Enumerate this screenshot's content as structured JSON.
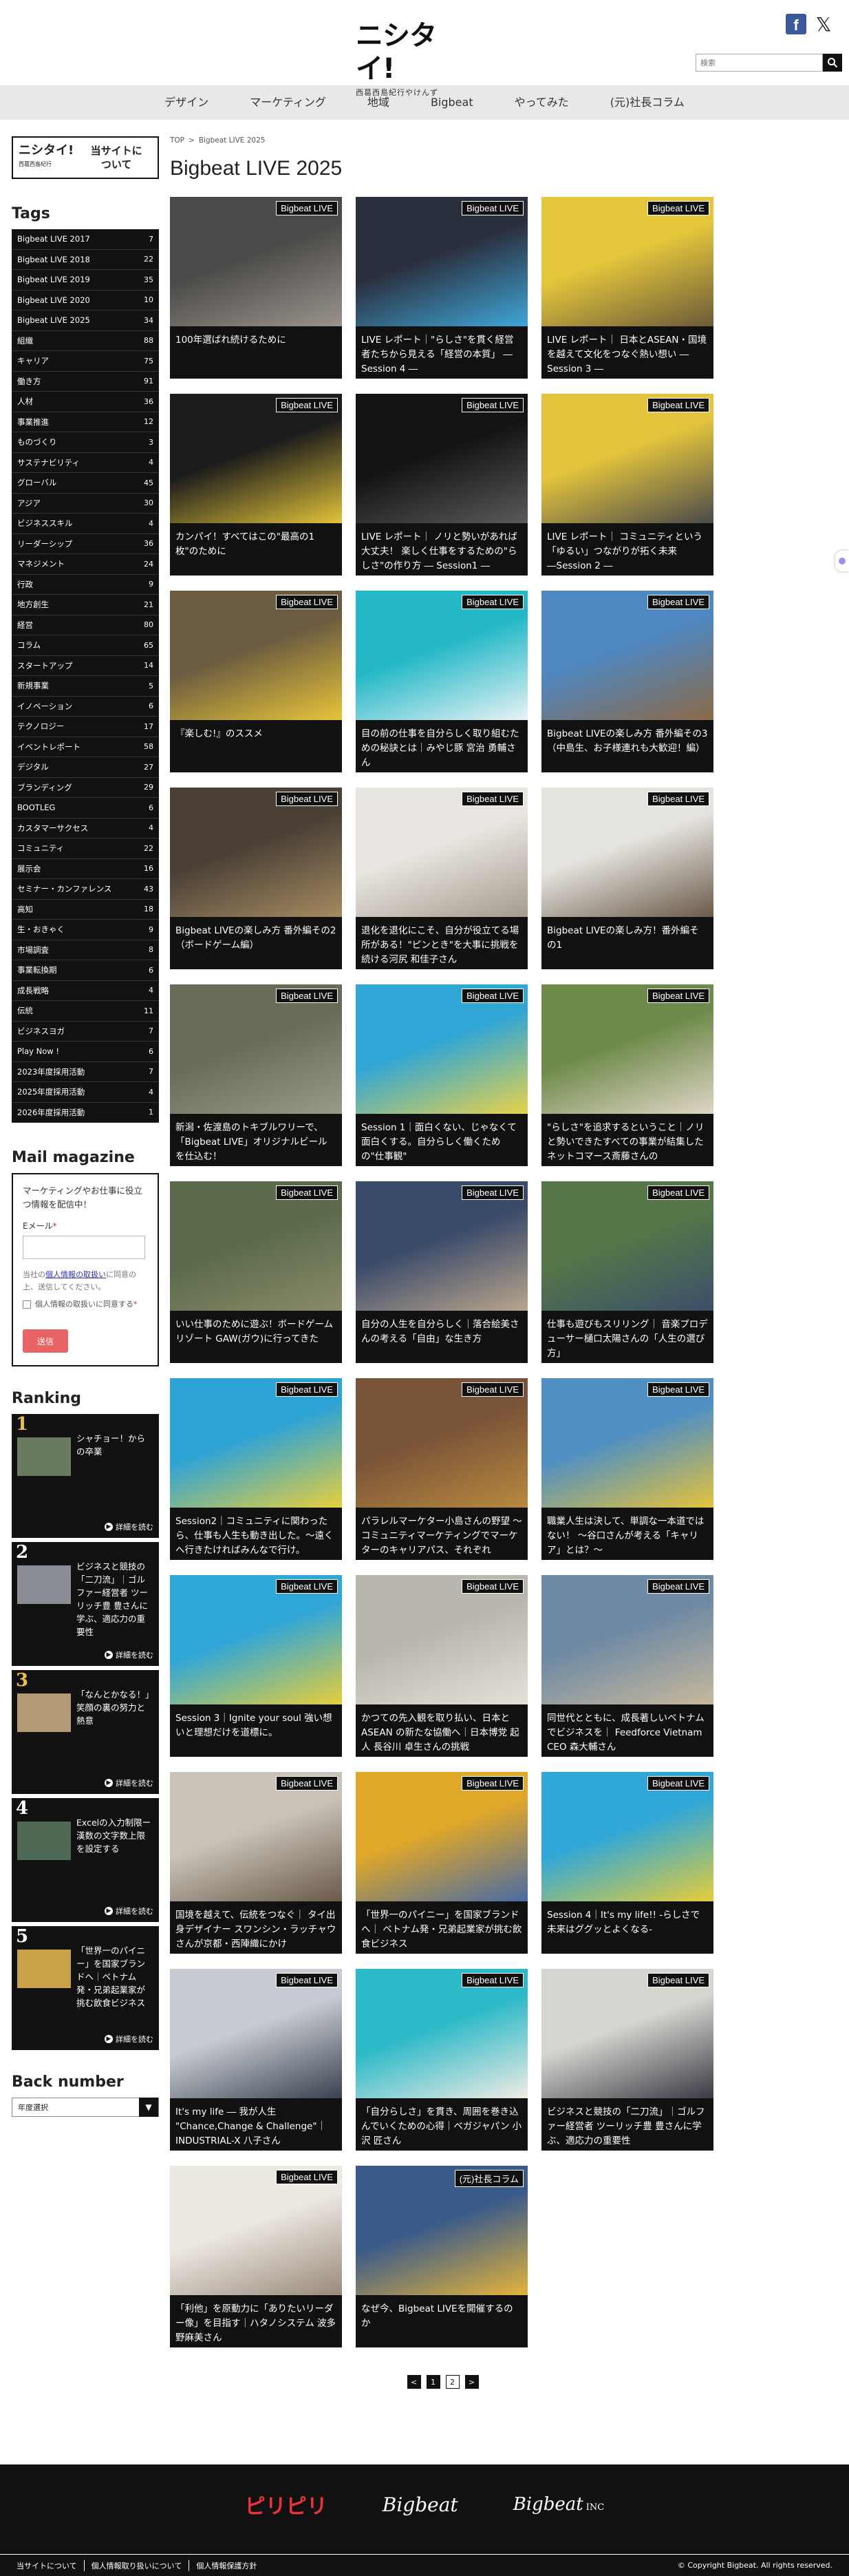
{
  "header": {
    "logo_main": "ニシタイ!",
    "logo_sub": "西葛西島紀行やけんず",
    "search_placeholder": "検索",
    "search_icon": "magnifier-icon",
    "facebook_glyph": "f",
    "x_glyph": "𝕏"
  },
  "nav": [
    "デザイン",
    "マーケティング",
    "地域",
    "Bigbeat",
    "やってみた",
    "(元)社長コラム"
  ],
  "about": {
    "logo": "ニシタイ!",
    "logo_sub": "西葛西島紀行",
    "text_line1": "当サイトに",
    "text_line2": "ついて"
  },
  "tags_heading": "Tags",
  "tags": [
    {
      "label": "Bigbeat LIVE 2017",
      "count": "7"
    },
    {
      "label": "Bigbeat LIVE 2018",
      "count": "22"
    },
    {
      "label": "Bigbeat LIVE 2019",
      "count": "35"
    },
    {
      "label": "Bigbeat LIVE 2020",
      "count": "10"
    },
    {
      "label": "Bigbeat LIVE 2025",
      "count": "34"
    },
    {
      "label": "組織",
      "count": "88"
    },
    {
      "label": "キャリア",
      "count": "75"
    },
    {
      "label": "働き方",
      "count": "91"
    },
    {
      "label": "人材",
      "count": "36"
    },
    {
      "label": "事業推進",
      "count": "12"
    },
    {
      "label": "ものづくり",
      "count": "3"
    },
    {
      "label": "サステナビリティ",
      "count": "4"
    },
    {
      "label": "グローバル",
      "count": "45"
    },
    {
      "label": "アジア",
      "count": "30"
    },
    {
      "label": "ビジネススキル",
      "count": "4"
    },
    {
      "label": "リーダーシップ",
      "count": "36"
    },
    {
      "label": "マネジメント",
      "count": "24"
    },
    {
      "label": "行政",
      "count": "9"
    },
    {
      "label": "地方創生",
      "count": "21"
    },
    {
      "label": "経営",
      "count": "80"
    },
    {
      "label": "コラム",
      "count": "65"
    },
    {
      "label": "スタートアップ",
      "count": "14"
    },
    {
      "label": "新規事業",
      "count": "5"
    },
    {
      "label": "イノベーション",
      "count": "6"
    },
    {
      "label": "テクノロジー",
      "count": "17"
    },
    {
      "label": "イベントレポート",
      "count": "58"
    },
    {
      "label": "デジタル",
      "count": "27"
    },
    {
      "label": "ブランディング",
      "count": "29"
    },
    {
      "label": "BOOTLEG",
      "count": "6"
    },
    {
      "label": "カスタマーサクセス",
      "count": "4"
    },
    {
      "label": "コミュニティ",
      "count": "22"
    },
    {
      "label": "展示会",
      "count": "16"
    },
    {
      "label": "セミナー・カンファレンス",
      "count": "43"
    },
    {
      "label": "高知",
      "count": "18"
    },
    {
      "label": "生・おきゃく",
      "count": "9"
    },
    {
      "label": "市場調査",
      "count": "8"
    },
    {
      "label": "事業転換期",
      "count": "6"
    },
    {
      "label": "成長戦略",
      "count": "4"
    },
    {
      "label": "伝統",
      "count": "11"
    },
    {
      "label": "ビジネスヨガ",
      "count": "7"
    },
    {
      "label": "Play Now !",
      "count": "6"
    },
    {
      "label": "2023年度採用活動",
      "count": "7"
    },
    {
      "label": "2025年度採用活動",
      "count": "4"
    },
    {
      "label": "2026年度採用活動",
      "count": "1"
    }
  ],
  "mail": {
    "heading": "Mail magazine",
    "desc": "マーケティングやお仕事に役立つ情報を配信中！",
    "email_label": "Eメール",
    "required_mark": "*",
    "policy_pre": "当社の",
    "policy_link": "個人情報の取扱い",
    "policy_post": "に同意の上、送信してください。",
    "check_label": "個人情報の取扱いに同意する",
    "check_required": "*",
    "send_label": "送信"
  },
  "ranking_heading": "Ranking",
  "ranking": [
    {
      "num": "1",
      "title": "シャチョー！からの卒業",
      "more": "詳細を読む",
      "thumb_color": "#6a7a5e",
      "gold": true
    },
    {
      "num": "2",
      "title": "ビジネスと競技の「二刀流」｜ゴルファー経営者 ツーリッチ豊 豊さんに学ぶ、適応力の重要性",
      "more": "詳細を読む",
      "thumb_color": "#8a8e94",
      "gold": false
    },
    {
      "num": "3",
      "title": "「なんとかなる！」笑顔の裏の努力と熱意",
      "more": "詳細を読む",
      "thumb_color": "#b59a76",
      "gold": true
    },
    {
      "num": "4",
      "title": "Excelの入力制限ー漢数の文字数上限を設定する",
      "more": "詳細を読む",
      "thumb_color": "#4e6a54",
      "gold": false
    },
    {
      "num": "5",
      "title": "「世界一のパイニー」を国家ブランドへ｜ベトナム発・兄弟起業家が挑む飲食ビジネス",
      "more": "詳細を読む",
      "thumb_color": "#c9a24a",
      "gold": false
    }
  ],
  "back_number": {
    "heading": "Back number",
    "select_value": "年度選択",
    "arrow_icon": "chevron-down-icon"
  },
  "breadcrumb": {
    "home": "TOP",
    "sep": ">",
    "current": "Bigbeat LIVE 2025"
  },
  "page_title": "Bigbeat LIVE 2025",
  "cards": [
    {
      "tag": "Bigbeat LIVE",
      "title": "100年選ばれ続けるために",
      "c1": "#4b4a48",
      "c2": "#9a938c"
    },
    {
      "tag": "Bigbeat LIVE",
      "title": "LIVE レポート｜\"らしさ\"を貫く経営者たちから見える「経営の本質」 ― Session 4 ―",
      "c1": "#2a2f3d",
      "c2": "#3fa6d8"
    },
    {
      "tag": "Bigbeat LIVE",
      "title": "LIVE レポート｜ 日本とASEAN・国境を越えて文化をつなぐ熱い想い ― Session 3 ―",
      "c1": "#e5c73b",
      "c2": "#6b5a3a"
    },
    {
      "tag": "Bigbeat LIVE",
      "title": "カンパイ！すべてはこの\"最高の1枚\"のために",
      "c1": "#1c1c1c",
      "c2": "#e2c33a"
    },
    {
      "tag": "Bigbeat LIVE",
      "title": "LIVE レポート｜ ノリと勢いがあれば大丈夫！ 楽しく仕事をするための\"らしさ\"の作り方 ― Session1 ―",
      "c1": "#131313",
      "c2": "#5a5a5a"
    },
    {
      "tag": "Bigbeat LIVE",
      "title": "LIVE レポート｜ コミュニティという「ゆるい」つながりが拓く未来 ―Session 2 ―",
      "c1": "#e3c43c",
      "c2": "#4a4a4a"
    },
    {
      "tag": "Bigbeat LIVE",
      "title": "『楽しむ!』のススメ",
      "c1": "#6b5b40",
      "c2": "#e7c43a"
    },
    {
      "tag": "Bigbeat LIVE",
      "title": "目の前の仕事を自分らしく取り組むための秘訣とは｜みやじ豚 宮治 勇輔さん",
      "c1": "#24b8c7",
      "c2": "#e8f3f5"
    },
    {
      "tag": "Bigbeat LIVE",
      "title": "Bigbeat LIVEの楽しみ方 番外編その3（中島生、お子様連れも大歓迎！編）",
      "c1": "#4f87c0",
      "c2": "#8b6a48"
    },
    {
      "tag": "Bigbeat LIVE",
      "title": "Bigbeat LIVEの楽しみ方 番外編その2（ボードゲーム編）",
      "c1": "#4a4036",
      "c2": "#a58a60"
    },
    {
      "tag": "Bigbeat LIVE",
      "title": "退化を退化にこそ、自分が役立てる場所がある！\"ピンとき\"を大事に挑戦を続ける河尻 和佳子さん",
      "c1": "#e9e6e1",
      "c2": "#a59b8e"
    },
    {
      "tag": "Bigbeat LIVE",
      "title": "Bigbeat LIVEの楽しみ方！番外編その1",
      "c1": "#e5e3de",
      "c2": "#6a5a4a"
    },
    {
      "tag": "Bigbeat LIVE",
      "title": "新潟・佐渡島のトキブルワリーで、「Bigbeat LIVE」オリジナルビールを仕込む！",
      "c1": "#6a6a58",
      "c2": "#9a9a88"
    },
    {
      "tag": "Bigbeat LIVE",
      "title": "Session 1｜面白くない、じゃなくて面白くする。自分らしく働くための\"仕事観\"",
      "c1": "#30a6d6",
      "c2": "#e8d24a"
    },
    {
      "tag": "Bigbeat LIVE",
      "title": "\"らしさ\"を追求するということ｜ノリと勢いできたすべての事業が結集したネットコマース斎藤さんの",
      "c1": "#6e8a4a",
      "c2": "#e0d6c6"
    },
    {
      "tag": "Bigbeat LIVE",
      "title": "いい仕事のために遊ぶ！ボードゲームリゾート GAW(ガウ)に行ってきた",
      "c1": "#5a6a4a",
      "c2": "#8a8a6a"
    },
    {
      "tag": "Bigbeat LIVE",
      "title": "自分の人生を自分らしく｜落合絵美さんの考える「自由」な生き方",
      "c1": "#3a4a6a",
      "c2": "#b9a58c"
    },
    {
      "tag": "Bigbeat LIVE",
      "title": "仕事も遊びもスリリング｜ 音楽プロデューサー樋口太陽さんの「人生の選び方」",
      "c1": "#557748",
      "c2": "#3b4f6a"
    },
    {
      "tag": "Bigbeat LIVE",
      "title": "Session2｜コミュニティに関わったら、仕事も人生も動き出した。〜遠くへ行きたければみんなで行け。",
      "c1": "#2ea3d5",
      "c2": "#e7cf3c"
    },
    {
      "tag": "Bigbeat LIVE",
      "title": "パラレルマーケター小島さんの野望 〜コミュニティマーケティングでマーケターのキャリアパス、それぞれ",
      "c1": "#7a5438",
      "c2": "#b8893e"
    },
    {
      "tag": "Bigbeat LIVE",
      "title": "職業人生は決して、単調な一本道ではない！ 〜谷口さんが考える「キャリア」とは？〜",
      "c1": "#4f8fc4",
      "c2": "#e4c33a"
    },
    {
      "tag": "Bigbeat LIVE",
      "title": "Session 3｜Ignite your soul 強い想いと理想だけを道標に。",
      "c1": "#2fa6d8",
      "c2": "#e6ce3a"
    },
    {
      "tag": "Bigbeat LIVE",
      "title": "かつての先入観を取り払い、日本とASEAN の新たな協働へ｜日本博党 起人 長谷川 卓生さんの挑戦",
      "c1": "#b9b6ae",
      "c2": "#e5e1d8"
    },
    {
      "tag": "Bigbeat LIVE",
      "title": "同世代とともに、成長著しいベトナムでビジネスを｜ Feedforce Vietnam CEO 森大輔さん",
      "c1": "#6f8aa4",
      "c2": "#c7b89c"
    },
    {
      "tag": "Bigbeat LIVE",
      "title": "国境を越えて、伝統をつなぐ｜ タイ出身デザイナー スワンシン・ラッチャウさんが京都・西陣織にかけ",
      "c1": "#c9c2b8",
      "c2": "#6a5a4a"
    },
    {
      "tag": "Bigbeat LIVE",
      "title": "「世界一のパイニー」を国家ブランドへ｜ ベトナム発・兄弟起業家が挑む飲食ビジネス",
      "c1": "#e0a828",
      "c2": "#4a6aa4"
    },
    {
      "tag": "Bigbeat LIVE",
      "title": "Session 4｜It's my life!! -らしさで未来はググッとよくなる-",
      "c1": "#2fa7d8",
      "c2": "#e5cd3a"
    },
    {
      "tag": "Bigbeat LIVE",
      "title": "It's my life ― 我が人生 \"Chance,Change & Challenge\"｜INDUSTRIAL-X 八子さん",
      "c1": "#c8ccd2",
      "c2": "#3a4250"
    },
    {
      "tag": "Bigbeat LIVE",
      "title": "「自分らしさ」を貫き、周囲を巻き込んでいくための心得｜ベガジャパン 小沢 匠さん",
      "c1": "#2cb9c8",
      "c2": "#f0ece4"
    },
    {
      "tag": "Bigbeat LIVE",
      "title": "ビジネスと競技の「二刀流」｜ゴルファー経営者 ツーリッチ豊 豊さんに学ぶ、適応力の重要性",
      "c1": "#d7d5d0",
      "c2": "#3a3a44"
    },
    {
      "tag": "Bigbeat LIVE",
      "title": "「利他」を原動力に「ありたいリーダー像」を目指す｜ハタノシステム 波多野麻美さん",
      "c1": "#ece8e2",
      "c2": "#9a8a7a"
    },
    {
      "tag": "(元)社長コラム",
      "title": "なぜ今、Bigbeat LIVEを開催するのか",
      "c1": "#3a5a8a",
      "c2": "#e4b43a"
    }
  ],
  "pagination": {
    "prev": "<",
    "p1": "1",
    "p2": "2",
    "next": ">"
  },
  "footer": {
    "logo1": "ピリピリ",
    "logo2": "Bigbeat",
    "logo3": "Bigbeat",
    "logo3_suffix": "INC",
    "links": [
      "当サイトについて",
      "個人情報取り扱いについて",
      "個人情報保護方針"
    ],
    "copyright": "© Copyright Bigbeat. All rights reserved."
  }
}
